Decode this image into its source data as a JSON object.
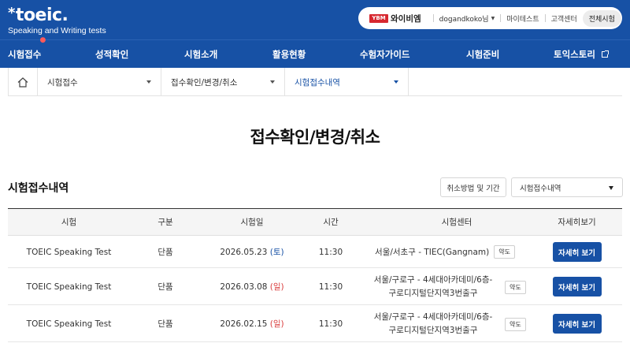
{
  "brand": {
    "logo_text": "toeic.",
    "logo_star": "*",
    "tagline": "Speaking and Writing tests"
  },
  "user_bar": {
    "partner_logo": "YBM",
    "partner_name": "와이비엠",
    "user_name": "dogandkoko님",
    "links": [
      "마이테스트",
      "고객센터"
    ],
    "all_button": "전체시험"
  },
  "nav": {
    "items": [
      {
        "label": "시험접수",
        "dot": "●"
      },
      {
        "label": "성적확인"
      },
      {
        "label": "시험소개"
      },
      {
        "label": "활용현황"
      },
      {
        "label": "수험자가이드"
      },
      {
        "label": "시험준비"
      },
      {
        "label": "토익스토리"
      }
    ]
  },
  "breadcrumb": [
    "시험접수",
    "접수확인/변경/취소",
    "시험접수내역"
  ],
  "page_title": "접수확인/변경/취소",
  "section": {
    "title": "시험접수내역",
    "cancel_info_button": "취소방법 및 기간",
    "select_value": "시험접수내역"
  },
  "table": {
    "headers": [
      "시험",
      "구분",
      "시험일",
      "시간",
      "시험센터",
      "자세히보기"
    ],
    "rows": [
      {
        "test": "TOEIC Speaking Test",
        "type": "단품",
        "date": "2026.05.23",
        "dow": "(토)",
        "time": "11:30",
        "center_line1": "서울/서초구 - TIEC(Gangnam)",
        "center_line2": "",
        "map": "약도",
        "detail": "자세히 보기"
      },
      {
        "test": "TOEIC Speaking Test",
        "type": "단품",
        "date": "2026.03.08",
        "dow": "(일)",
        "time": "11:30",
        "center_line1": "서울/구로구 - 4세대아카데미/6층-",
        "center_line2": "구로디지털단지역3번출구",
        "map": "약도",
        "detail": "자세히 보기"
      },
      {
        "test": "TOEIC Speaking Test",
        "type": "단품",
        "date": "2026.02.15",
        "dow": "(일)",
        "time": "11:30",
        "center_line1": "서울/구로구 - 4세대아카데미/6층-",
        "center_line2": "구로디지털단지역3번출구",
        "map": "약도",
        "detail": "자세히 보기"
      }
    ]
  },
  "colors": {
    "primary": "#1751a5",
    "sunday": "#d93b3b",
    "saturday": "#1751a5"
  },
  "icons": [
    "home-icon",
    "chevron-down-icon",
    "external-link-icon"
  ]
}
